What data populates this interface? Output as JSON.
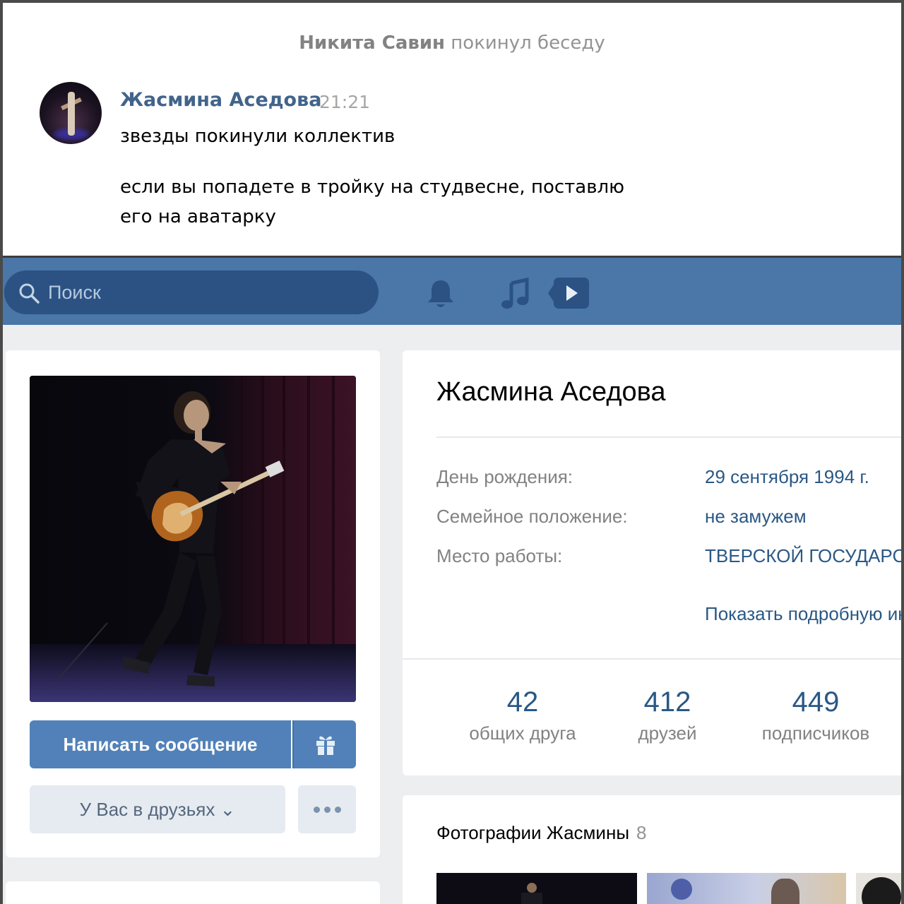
{
  "chat": {
    "system_user": "Никита Савин",
    "system_action": "покинул беседу",
    "author": "Жасмина Аседова",
    "time": "21:21",
    "line1": "звезды покинули коллектив",
    "line2": "если вы попадете в тройку на студвесне, поставлю",
    "line3": "его на аватарку"
  },
  "header": {
    "search_placeholder": "Поиск",
    "color": "#4a76a8"
  },
  "profile": {
    "name": "Жасмина Аседова",
    "message_button": "Написать сообщение",
    "friends_button": "У Вас в друзьях ⌄",
    "info": [
      {
        "label": "День рождения:",
        "value": "29 сентября 1994 г."
      },
      {
        "label": "Семейное положение:",
        "value": "не замужем"
      },
      {
        "label": "Место работы:",
        "value": "ТВЕРСКОЙ ГОСУДАРСТВЕННЫЙ"
      }
    ],
    "show_more": "Показать подробную информацию",
    "counters": [
      {
        "num": "42",
        "label": "общих друга"
      },
      {
        "num": "412",
        "label": "друзей"
      },
      {
        "num": "449",
        "label": "подписчиков"
      }
    ],
    "photos_title": "Фотографии Жасмины",
    "photos_count": "8"
  }
}
